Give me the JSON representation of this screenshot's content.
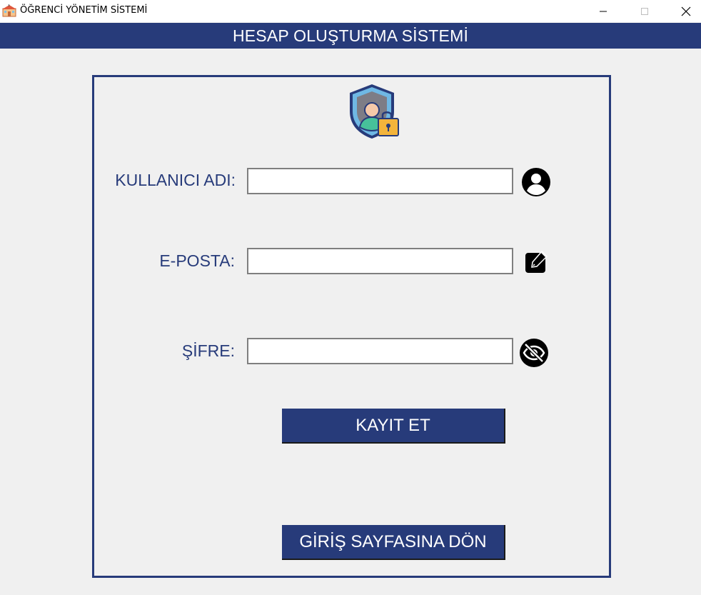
{
  "window": {
    "title": "ÖĞRENCİ YÖNETİM SİSTEMİ",
    "icon": "school-building-icon"
  },
  "header": {
    "title": "HESAP OLUŞTURMA SİSTEMİ"
  },
  "form": {
    "logo_icon": "shield-user-lock-icon",
    "username": {
      "label": "KULLANICI ADI:",
      "value": "",
      "icon": "user-circle-icon"
    },
    "email": {
      "label": "E-POSTA:",
      "value": "",
      "icon": "edit-square-icon"
    },
    "password": {
      "label": "ŞİFRE:",
      "value": "",
      "icon": "eye-slash-icon"
    },
    "register_button": "KAYIT ET",
    "back_button": "GİRİŞ SAYFASINA DÖN"
  },
  "colors": {
    "brand": "#273b7a",
    "background": "#f0f0f0",
    "input_border": "#7f7f7f"
  }
}
